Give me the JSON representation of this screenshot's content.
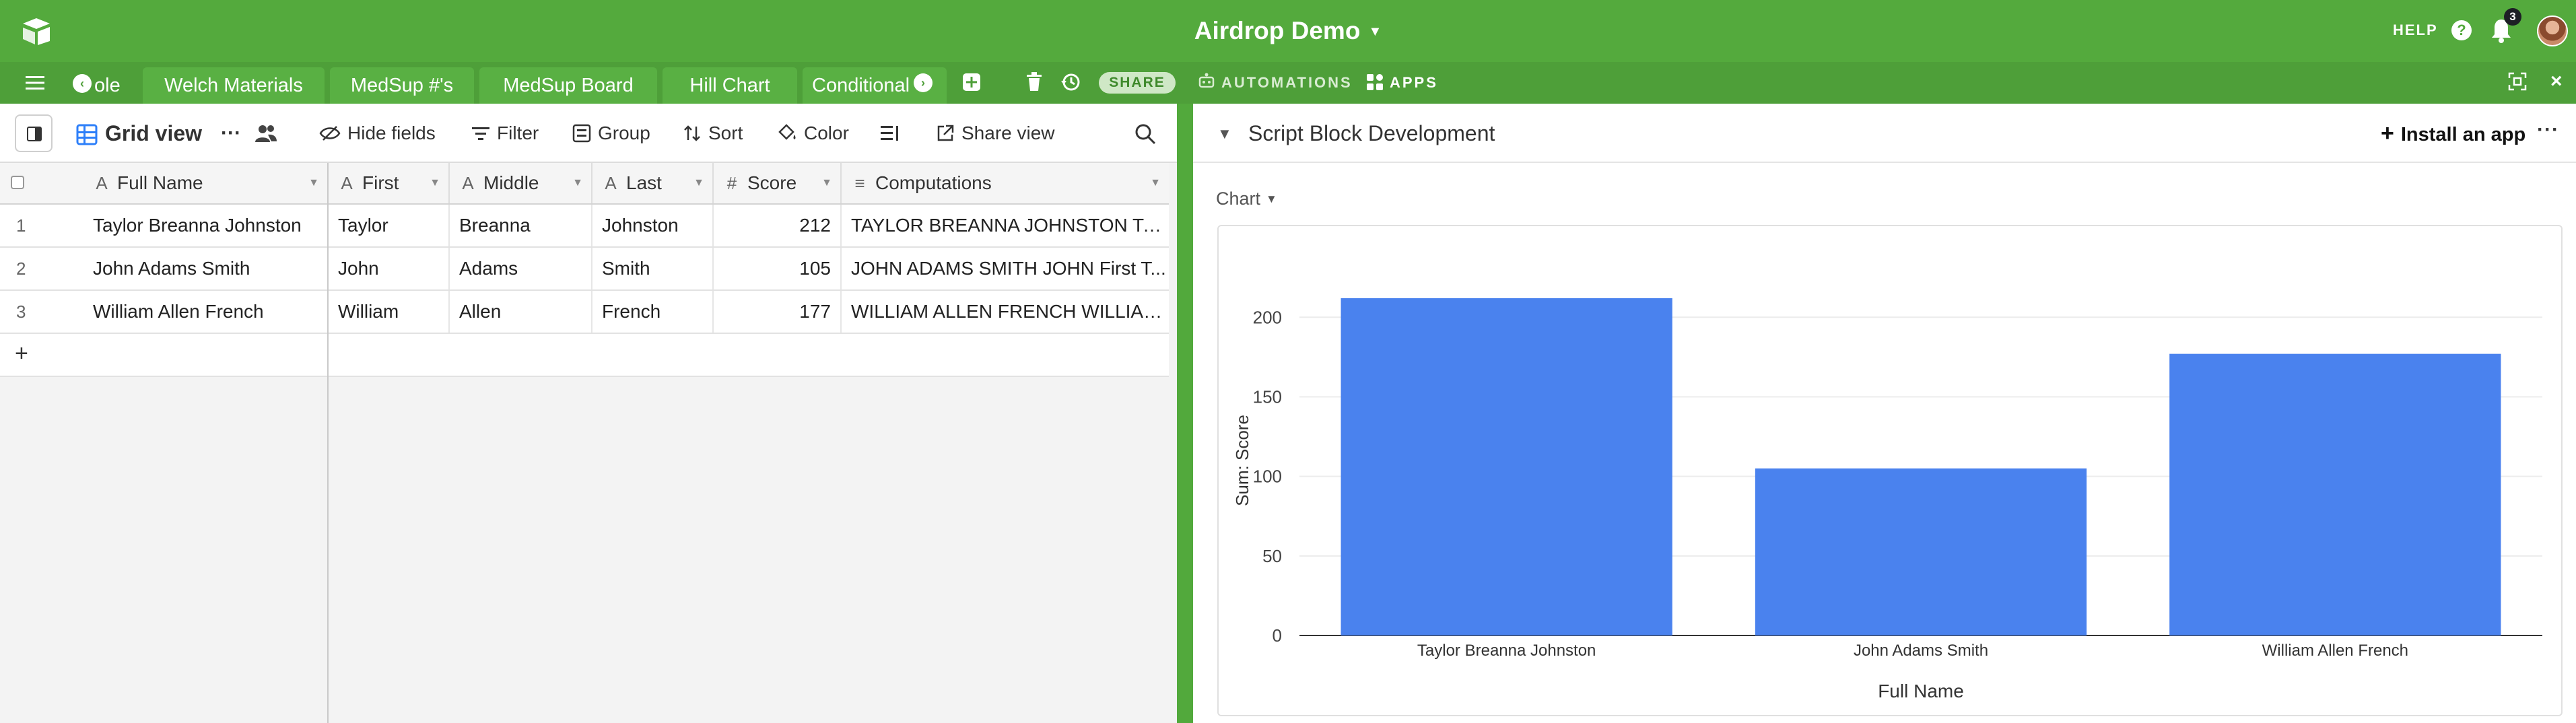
{
  "header": {
    "base_name": "Airdrop Demo",
    "help_label": "HELP",
    "notifications_count": "3"
  },
  "tabs": {
    "partial_left": "ole",
    "items": [
      {
        "label": "Welch Materials"
      },
      {
        "label": "MedSup #'s"
      },
      {
        "label": "MedSup Board"
      },
      {
        "label": "Hill Chart"
      },
      {
        "label": "Conditional"
      }
    ],
    "share_label": "SHARE",
    "automations_label": "AUTOMATIONS",
    "apps_label": "APPS"
  },
  "viewbar": {
    "view_name": "Grid view",
    "hide_fields": "Hide fields",
    "filter": "Filter",
    "group": "Group",
    "sort": "Sort",
    "color": "Color",
    "share_view": "Share view"
  },
  "table": {
    "columns": [
      {
        "label": "Full Name",
        "type_icon": "text-field-icon"
      },
      {
        "label": "First",
        "type_icon": "text-field-icon"
      },
      {
        "label": "Middle",
        "type_icon": "text-field-icon"
      },
      {
        "label": "Last",
        "type_icon": "text-field-icon"
      },
      {
        "label": "Score",
        "type_icon": "number-field-icon"
      },
      {
        "label": "Computations",
        "type_icon": "long-text-field-icon"
      }
    ],
    "rows": [
      {
        "num": "1",
        "full_name": "Taylor Breanna Johnston",
        "first": "Taylor",
        "middle": "Breanna",
        "last": "Johnston",
        "score": "212",
        "computations": "TAYLOR BREANNA JOHNSTON TAY..."
      },
      {
        "num": "2",
        "full_name": "John Adams Smith",
        "first": "John",
        "middle": "Adams",
        "last": "Smith",
        "score": "105",
        "computations": "JOHN ADAMS SMITH JOHN First T..."
      },
      {
        "num": "3",
        "full_name": "William Allen French",
        "first": "William",
        "middle": "Allen",
        "last": "French",
        "score": "177",
        "computations": "WILLIAM ALLEN FRENCH WILLIAM ..."
      }
    ],
    "add_row": "+"
  },
  "app_panel": {
    "title": "Script Block Development",
    "install_label": "Install an app",
    "chart_selector": "Chart"
  },
  "colors": {
    "brand_green": "#54aa3d",
    "bar_blue": "#4a82ee"
  },
  "chart_data": {
    "type": "bar",
    "categories": [
      "Taylor Breanna Johnston",
      "John Adams Smith",
      "William Allen French"
    ],
    "values": [
      212,
      105,
      177
    ],
    "xlabel": "Full Name",
    "ylabel": "Sum: Score",
    "ylim": [
      0,
      220
    ],
    "yticks": [
      0,
      50,
      100,
      150,
      200
    ],
    "grid": true
  }
}
